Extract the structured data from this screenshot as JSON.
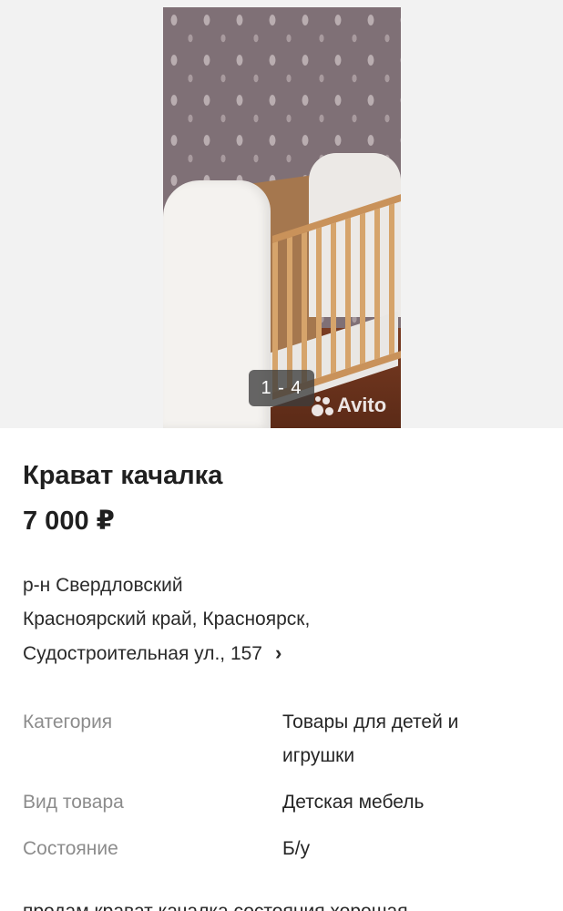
{
  "gallery": {
    "counter": "1 - 4",
    "watermark": "Avito"
  },
  "listing": {
    "title": "Крават качалка",
    "price": "7 000 ₽"
  },
  "address": {
    "district": "р-н Свердловский",
    "region_city": "Красноярский край, Красноярск,",
    "street": "Судостроительная ул., 157",
    "chevron": "›"
  },
  "params": [
    {
      "label": "Категория",
      "value": "Товары для детей и игрушки"
    },
    {
      "label": "Вид товара",
      "value": "Детская мебель"
    },
    {
      "label": "Состояние",
      "value": "Б/у"
    }
  ],
  "description": "продам  крават качалка,состояния  хорошая,"
}
